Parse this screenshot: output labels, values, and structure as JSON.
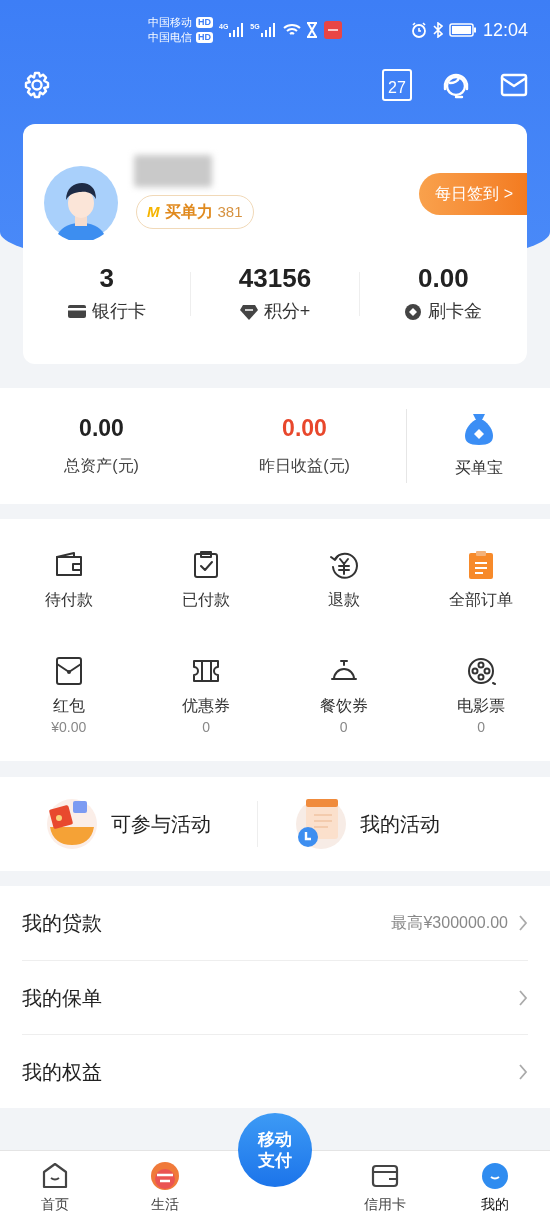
{
  "status_bar": {
    "carriers": [
      {
        "name": "中国移动",
        "badge": "HD"
      },
      {
        "name": "中国电信",
        "badge": "HD"
      }
    ],
    "networks": [
      "4G",
      "5G"
    ],
    "time": "12:04"
  },
  "header": {
    "calendar_day": "27"
  },
  "profile": {
    "badge_mark": "M",
    "badge_label": "买单力",
    "badge_value": "381",
    "sign_in": "每日签到 >",
    "stats": [
      {
        "value": "3",
        "label": "银行卡",
        "kind": "card"
      },
      {
        "value": "43156",
        "label": "积分+",
        "kind": "gem"
      },
      {
        "value": "0.00",
        "label": "刷卡金",
        "kind": "coin"
      }
    ]
  },
  "assets": {
    "items": [
      {
        "value": "0.00",
        "label": "总资产(元)",
        "highlight": false
      },
      {
        "value": "0.00",
        "label": "昨日收益(元)",
        "highlight": true
      }
    ],
    "shortcut": "买单宝"
  },
  "orders": [
    {
      "label": "待付款",
      "kind": "wallet"
    },
    {
      "label": "已付款",
      "kind": "clipboard"
    },
    {
      "label": "退款",
      "kind": "refund"
    },
    {
      "label": "全部订单",
      "kind": "orders"
    },
    {
      "label": "红包",
      "kind": "envelope",
      "sub": "¥0.00"
    },
    {
      "label": "优惠券",
      "kind": "ticket",
      "sub": "0"
    },
    {
      "label": "餐饮券",
      "kind": "dish",
      "sub": "0"
    },
    {
      "label": "电影票",
      "kind": "film",
      "sub": "0"
    }
  ],
  "activities": [
    {
      "label": "可参与活动",
      "kind": "gift"
    },
    {
      "label": "我的活动",
      "kind": "calendar"
    }
  ],
  "list": [
    {
      "label": "我的贷款",
      "detail": "最高¥300000.00"
    },
    {
      "label": "我的保单"
    },
    {
      "label": "我的权益"
    }
  ],
  "nav": {
    "items": [
      {
        "label": "首页",
        "kind": "home",
        "selected": false
      },
      {
        "label": "生活",
        "kind": "points",
        "selected": false
      },
      {
        "label": "信用卡",
        "kind": "card",
        "selected": false
      },
      {
        "label": "我的",
        "kind": "me",
        "selected": true
      }
    ],
    "center_button": [
      "移动",
      "支付"
    ]
  }
}
